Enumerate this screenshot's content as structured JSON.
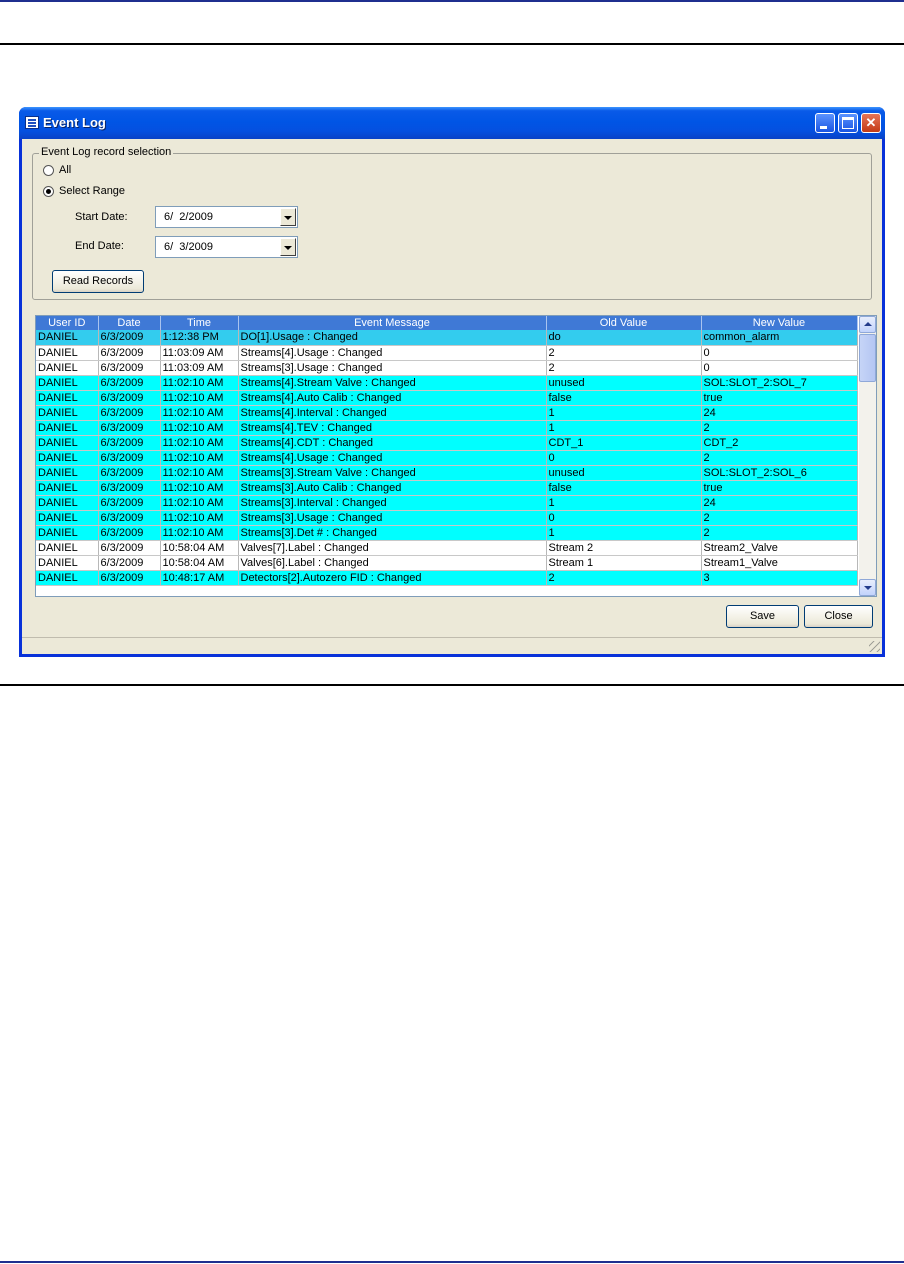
{
  "window": {
    "title": "Event Log"
  },
  "selection": {
    "group_label": "Event Log record selection",
    "all_label": "All",
    "range_label": "Select Range",
    "selected": "Select Range",
    "start_label": "Start Date:",
    "start_value": "6/  2/2009",
    "end_label": "End Date:",
    "end_value": "6/  3/2009",
    "read_button": "Read Records"
  },
  "grid": {
    "columns": [
      "User ID",
      "Date",
      "Time",
      "Event Message",
      "Old Value",
      "New Value"
    ],
    "rows": [
      {
        "cells": [
          "DANIEL",
          "6/3/2009",
          "1:12:38 PM",
          "DO[1].Usage : Changed",
          "do",
          "common_alarm"
        ],
        "style": "selected"
      },
      {
        "cells": [
          "DANIEL",
          "6/3/2009",
          "11:03:09 AM",
          "Streams[4].Usage : Changed",
          "2",
          "0"
        ],
        "style": "white"
      },
      {
        "cells": [
          "DANIEL",
          "6/3/2009",
          "11:03:09 AM",
          "Streams[3].Usage : Changed",
          "2",
          "0"
        ],
        "style": "white"
      },
      {
        "cells": [
          "DANIEL",
          "6/3/2009",
          "11:02:10 AM",
          "Streams[4].Stream Valve : Changed",
          "unused",
          "SOL:SLOT_2:SOL_7"
        ],
        "style": "cyan"
      },
      {
        "cells": [
          "DANIEL",
          "6/3/2009",
          "11:02:10 AM",
          "Streams[4].Auto Calib : Changed",
          "false",
          "true"
        ],
        "style": "cyan"
      },
      {
        "cells": [
          "DANIEL",
          "6/3/2009",
          "11:02:10 AM",
          "Streams[4].Interval : Changed",
          "1",
          "24"
        ],
        "style": "cyan"
      },
      {
        "cells": [
          "DANIEL",
          "6/3/2009",
          "11:02:10 AM",
          "Streams[4].TEV : Changed",
          "1",
          "2"
        ],
        "style": "cyan"
      },
      {
        "cells": [
          "DANIEL",
          "6/3/2009",
          "11:02:10 AM",
          "Streams[4].CDT : Changed",
          "CDT_1",
          "CDT_2"
        ],
        "style": "cyan"
      },
      {
        "cells": [
          "DANIEL",
          "6/3/2009",
          "11:02:10 AM",
          "Streams[4].Usage : Changed",
          "0",
          "2"
        ],
        "style": "cyan"
      },
      {
        "cells": [
          "DANIEL",
          "6/3/2009",
          "11:02:10 AM",
          "Streams[3].Stream Valve : Changed",
          "unused",
          "SOL:SLOT_2:SOL_6"
        ],
        "style": "cyan"
      },
      {
        "cells": [
          "DANIEL",
          "6/3/2009",
          "11:02:10 AM",
          "Streams[3].Auto Calib : Changed",
          "false",
          "true"
        ],
        "style": "cyan"
      },
      {
        "cells": [
          "DANIEL",
          "6/3/2009",
          "11:02:10 AM",
          "Streams[3].Interval : Changed",
          "1",
          "24"
        ],
        "style": "cyan"
      },
      {
        "cells": [
          "DANIEL",
          "6/3/2009",
          "11:02:10 AM",
          "Streams[3].Usage : Changed",
          "0",
          "2"
        ],
        "style": "cyan"
      },
      {
        "cells": [
          "DANIEL",
          "6/3/2009",
          "11:02:10 AM",
          "Streams[3].Det # : Changed",
          "1",
          "2"
        ],
        "style": "cyan"
      },
      {
        "cells": [
          "DANIEL",
          "6/3/2009",
          "10:58:04 AM",
          "Valves[7].Label : Changed",
          "Stream 2",
          "Stream2_Valve"
        ],
        "style": "white"
      },
      {
        "cells": [
          "DANIEL",
          "6/3/2009",
          "10:58:04 AM",
          "Valves[6].Label : Changed",
          "Stream 1",
          "Stream1_Valve"
        ],
        "style": "white"
      },
      {
        "cells": [
          "DANIEL",
          "6/3/2009",
          "10:48:17 AM",
          "Detectors[2].Autozero FID : Changed",
          "2",
          "3"
        ],
        "style": "cyan"
      }
    ]
  },
  "buttons": {
    "save": "Save",
    "close": "Close"
  },
  "colors": {
    "row_white": "#ffffff",
    "row_cyan": "#00ffff",
    "row_selected": "#33ccee",
    "header": "#3f79d6",
    "titlebar": "#0055e5"
  }
}
